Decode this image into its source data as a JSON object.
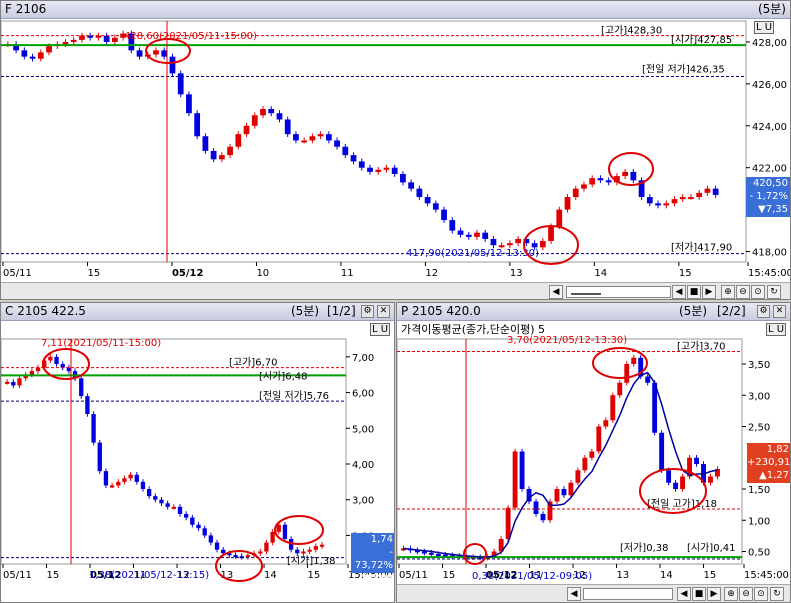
{
  "top": {
    "title": "F 2106",
    "period": "(5분)",
    "lu": "L U",
    "y_ticks": [
      "428,00",
      "426,00",
      "424,00",
      "422,00",
      "418,00"
    ],
    "x_ticks": [
      "05/11",
      "15",
      "05/12",
      "10",
      "11",
      "12",
      "13",
      "14",
      "15",
      "15:45:00"
    ],
    "annotations": {
      "high_marker": "428,60(2021/05/11-15:00)",
      "low_marker": "417,90(2021/05/12-13:30)",
      "goga": "[고가]428,30",
      "siga": "[시가]427,85",
      "prev_low": "[전일 저가]426,35",
      "jeoga": "[저가]417,90"
    },
    "price_box": {
      "price": "420,50",
      "change_pct": "- 1,72%",
      "change": "▼7,35"
    },
    "colors": {
      "up": "#e00000",
      "down": "#0000e0",
      "green": "#00a000",
      "ref": "#000080"
    },
    "chart_data": {
      "type": "candlestick",
      "ylim": [
        417.5,
        429
      ],
      "close_series": [
        427.9,
        427.6,
        427.3,
        427.2,
        427.5,
        427.8,
        427.9,
        428.0,
        428.1,
        428.3,
        428.2,
        428.3,
        428.0,
        428.2,
        428.4,
        427.6,
        427.3,
        427.4,
        427.6,
        427.3,
        426.5,
        425.5,
        424.6,
        423.5,
        422.8,
        422.4,
        422.6,
        423.0,
        423.6,
        424.0,
        424.5,
        424.8,
        424.6,
        424.3,
        423.6,
        423.3,
        423.3,
        423.5,
        423.6,
        423.3,
        423.0,
        422.6,
        422.3,
        422.0,
        421.8,
        421.9,
        422.0,
        421.7,
        421.3,
        421.0,
        420.6,
        420.3,
        420.0,
        419.5,
        419.0,
        418.8,
        418.7,
        418.9,
        418.6,
        418.3,
        418.3,
        418.4,
        418.6,
        418.4,
        418.2,
        418.5,
        419.2,
        420.0,
        420.6,
        421.0,
        421.2,
        421.5,
        421.4,
        421.3,
        421.6,
        421.8,
        421.4,
        420.6,
        420.3,
        420.2,
        420.3,
        420.5,
        420.6,
        420.6,
        420.8,
        421.0,
        420.7
      ]
    }
  },
  "left": {
    "title": "C 2105 422.5",
    "period": "(5분)",
    "paging": "[1/2]",
    "lu": "L U",
    "y_ticks": [
      "7,00",
      "6,00",
      "5,00",
      "4,00",
      "3,00",
      "2,00"
    ],
    "x_ticks": [
      "05/11",
      "15",
      "05/12",
      "11",
      "12",
      "13",
      "14",
      "15",
      "15:45:00"
    ],
    "annotations": {
      "high_marker": "7,11(2021/05/11-15:00)",
      "low_marker": "1,38(2021/05/12-13:15)",
      "goga": "[고가]6,70",
      "siga": "[시가]6,48",
      "prev_low": "[전일 저가]5,76",
      "siga_bottom": "[시가]1,38"
    },
    "price_box": {
      "price": "1,74",
      "change_pct": "- 73,72%",
      "change": "▼4,88"
    },
    "chart_data": {
      "type": "candlestick",
      "ylim": [
        1.2,
        7.5
      ],
      "close_series": [
        6.3,
        6.2,
        6.4,
        6.5,
        6.6,
        6.7,
        6.9,
        7.0,
        6.8,
        6.7,
        6.6,
        6.4,
        5.9,
        5.4,
        4.6,
        3.8,
        3.4,
        3.4,
        3.5,
        3.6,
        3.7,
        3.5,
        3.3,
        3.1,
        3.0,
        2.9,
        2.8,
        2.8,
        2.6,
        2.5,
        2.3,
        2.2,
        2.0,
        1.8,
        1.6,
        1.5,
        1.45,
        1.42,
        1.4,
        1.45,
        1.5,
        1.55,
        1.8,
        2.1,
        2.3,
        1.9,
        1.6,
        1.5,
        1.55,
        1.6,
        1.7,
        1.74
      ]
    }
  },
  "right": {
    "title": "P 2105 420.0",
    "period": "(5분)",
    "paging": "[2/2]",
    "lu": "L U",
    "indicator_label": "가격이동평균(종가,단순이평) 5",
    "y_ticks": [
      "3,50",
      "3,00",
      "2,50",
      "1,50",
      "1,00",
      "0,50"
    ],
    "x_ticks": [
      "05/11",
      "15",
      "05/12",
      "11",
      "12",
      "13",
      "14",
      "15",
      "15:45:00"
    ],
    "annotations": {
      "high_marker": "3,70(2021/05/12-13:30)",
      "goga": "[고가]3,70",
      "prev_high": "[전일 고가]1,18",
      "low_marker": "0,38(2021/05/12-09:05)",
      "jeoga": "[저가]0,38",
      "siga": "[시가]0,41"
    },
    "price_box": {
      "price": "1,82",
      "change_pct": "+230,91%",
      "change": "▲1,27"
    },
    "chart_data": {
      "type": "candlestick",
      "ylim": [
        0.3,
        3.9
      ],
      "close_series": [
        0.55,
        0.52,
        0.5,
        0.48,
        0.46,
        0.45,
        0.44,
        0.43,
        0.42,
        0.41,
        0.41,
        0.4,
        0.42,
        0.5,
        0.7,
        1.2,
        2.1,
        1.5,
        1.3,
        1.1,
        1.0,
        1.3,
        1.5,
        1.4,
        1.6,
        1.8,
        2.0,
        2.1,
        2.5,
        2.6,
        3.0,
        3.2,
        3.5,
        3.6,
        3.3,
        3.2,
        2.4,
        1.8,
        1.6,
        1.5,
        1.7,
        2.0,
        1.9,
        1.6,
        1.7,
        1.82
      ]
    }
  },
  "scroll_icons": [
    "left-arrow-icon",
    "right-arrow-icon",
    "stop-icon",
    "zoom-in-icon",
    "zoom-out-icon",
    "zoom-fit-icon",
    "reset-icon"
  ]
}
